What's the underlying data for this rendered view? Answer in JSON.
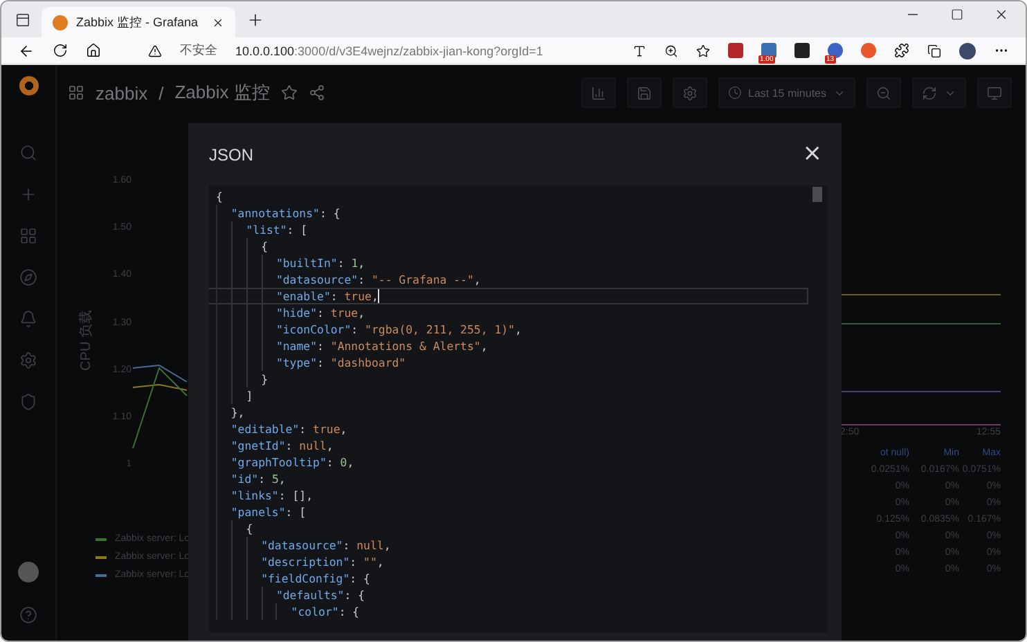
{
  "browser": {
    "tab_title": "Zabbix 监控 - Grafana",
    "security": "不安全",
    "url_host": "10.0.0.100",
    "url_rest": ":3000/d/v3E4wejnz/zabbix-jian-kong?orgId=1",
    "extension_badges": [
      "1.00",
      "13"
    ]
  },
  "breadcrumb": {
    "folder": "zabbix",
    "separator": "/",
    "dashboard": "Zabbix 监控"
  },
  "time_picker": "Last 15 minutes",
  "left_panel": {
    "ylabel": "CPU 负载",
    "y_ticks": [
      "1.60",
      "1.50",
      "1.40",
      "1.30",
      "1.20",
      "1.10",
      "1"
    ],
    "legend": [
      {
        "label": "Zabbix server: Lo",
        "color": "#3d6e36"
      },
      {
        "label": "Zabbix server: Lo",
        "color": "#8c7a14"
      },
      {
        "label": "Zabbix server: Lo",
        "color": "#4d6894"
      }
    ]
  },
  "right_panel": {
    "x_ticks": [
      "2:50",
      "12:55"
    ],
    "columns": [
      "ot null)",
      "Min",
      "Max"
    ],
    "rows": [
      [
        "0.0251%",
        "0.0167%",
        "0.0751%"
      ],
      [
        "0%",
        "0%",
        "0%"
      ],
      [
        "0%",
        "0%",
        "0%"
      ],
      [
        "0.125%",
        "0.0835%",
        "0.167%"
      ],
      [
        "0%",
        "0%",
        "0%"
      ],
      [
        "0%",
        "0%",
        "0%"
      ],
      [
        "0%",
        "0%",
        "0%"
      ]
    ]
  },
  "modal": {
    "title": "JSON",
    "close": "×",
    "lines": [
      {
        "text": "{",
        "current": false
      },
      {
        "text": "  \"annotations\": {",
        "current": false
      },
      {
        "text": "    \"list\": [",
        "current": false
      },
      {
        "text": "      {",
        "current": false
      },
      {
        "text": "        \"builtIn\": 1,",
        "current": false
      },
      {
        "text": "        \"datasource\": \"-- Grafana --\",",
        "current": false
      },
      {
        "text": "        \"enable\": true,",
        "current": true
      },
      {
        "text": "        \"hide\": true,",
        "current": false
      },
      {
        "text": "        \"iconColor\": \"rgba(0, 211, 255, 1)\",",
        "current": false
      },
      {
        "text": "        \"name\": \"Annotations & Alerts\",",
        "current": false
      },
      {
        "text": "        \"type\": \"dashboard\"",
        "current": false
      },
      {
        "text": "      }",
        "current": false
      },
      {
        "text": "    ]",
        "current": false
      },
      {
        "text": "  },",
        "current": false
      },
      {
        "text": "  \"editable\": true,",
        "current": false
      },
      {
        "text": "  \"gnetId\": null,",
        "current": false
      },
      {
        "text": "  \"graphTooltip\": 0,",
        "current": false
      },
      {
        "text": "  \"id\": 5,",
        "current": false
      },
      {
        "text": "  \"links\": [],",
        "current": false
      },
      {
        "text": "  \"panels\": [",
        "current": false
      },
      {
        "text": "    {",
        "current": false
      },
      {
        "text": "      \"datasource\": null,",
        "current": false
      },
      {
        "text": "      \"description\": \"\",",
        "current": false
      },
      {
        "text": "      \"fieldConfig\": {",
        "current": false
      },
      {
        "text": "        \"defaults\": {",
        "current": false
      },
      {
        "text": "          \"color\": {",
        "current": false
      }
    ]
  }
}
